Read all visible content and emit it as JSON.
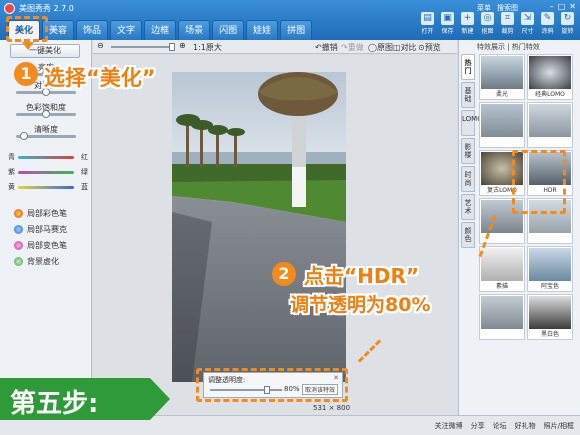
{
  "app": {
    "title": "美图秀秀 2.7.0"
  },
  "tabs": [
    "美化",
    "美容",
    "饰品",
    "文字",
    "边框",
    "场景",
    "闪图",
    "娃娃",
    "拼图"
  ],
  "top_menu": [
    "菜单",
    "搜索图"
  ],
  "toolbar": [
    "打开",
    "保存",
    "新建",
    "抠图",
    "裁剪",
    "尺寸",
    "涂鸦",
    "旋转"
  ],
  "zoom": {
    "label": "1:1原大"
  },
  "edit_actions": [
    "撤销",
    "重做",
    "原图",
    "对比",
    "预览"
  ],
  "left_panel": {
    "one_click": "一键美化",
    "sliders": [
      "亮度",
      "对比度",
      "色彩饱和度",
      "清晰度"
    ],
    "color_balance": [
      {
        "left": "青",
        "right": "红"
      },
      {
        "left": "紫",
        "right": "绿"
      },
      {
        "left": "黄",
        "right": "蓝"
      }
    ],
    "brushes": [
      "局部彩色笔",
      "局部马赛克",
      "局部变色笔",
      "背景虚化"
    ]
  },
  "right_panel": {
    "header": "特效展示 | 热门特效",
    "vertical_tabs": [
      "热门",
      "基础",
      "LOMO",
      "影楼",
      "时尚",
      "艺术",
      "颜色"
    ],
    "effects": [
      "柔光",
      "经典LOMO",
      "",
      "",
      "复古LOMO",
      "HDR",
      "",
      "",
      "素描",
      "阿宝色",
      "",
      "黑白色"
    ]
  },
  "dialog": {
    "label": "调整透明度:",
    "value": "80%",
    "cancel": "取消该特效"
  },
  "image_size": "531 × 800",
  "status_links": [
    "关注微博",
    "分享",
    "论坛",
    "好礼物",
    "照片/相框"
  ],
  "annotations": {
    "step1_num": "1",
    "step1_text": "选择“美化”",
    "step2_num": "2",
    "step2_line1": "点击“HDR”",
    "step2_line2": "调节透明为80%",
    "step_banner": "第五步:"
  },
  "colors": {
    "accent": "#f28a1c",
    "title_blue": "#1f6bb8",
    "banner_green": "#2f9a3a"
  }
}
